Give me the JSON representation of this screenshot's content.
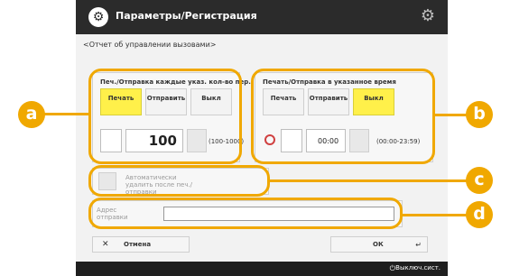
{
  "header": {
    "title": "Параметры/Регистрация",
    "app_icon": "settings-app-icon",
    "gear_icon": "gear-icon"
  },
  "subtitle": "<Отчет об управлении вызовами>",
  "section_a": {
    "label": "Печ./Отправка каждые указ. кол-во пер.",
    "options": [
      "Печать",
      "Отправить",
      "Выкл"
    ],
    "selected": "Печать",
    "value": "100",
    "range": "(100-1000)"
  },
  "section_b": {
    "label": "Печать/Отправка в указанное время",
    "options": [
      "Печать",
      "Отправить",
      "Выкл"
    ],
    "selected": "Выкл",
    "time": "00:00",
    "range": "(00:00-23:59)"
  },
  "section_c": {
    "label": "Автоматически удалить после печ./отправки"
  },
  "section_d": {
    "label": "Адрес отправки",
    "value": ""
  },
  "footer": {
    "cancel_label": "Отмена",
    "ok_label": "ОК",
    "status_label": "Выключ.сист."
  },
  "callouts": {
    "a": "a",
    "b": "b",
    "c": "c",
    "d": "d"
  },
  "colors": {
    "selected": "#fff04a",
    "callout": "#f0a800",
    "titlebar": "#2b2b2b"
  }
}
